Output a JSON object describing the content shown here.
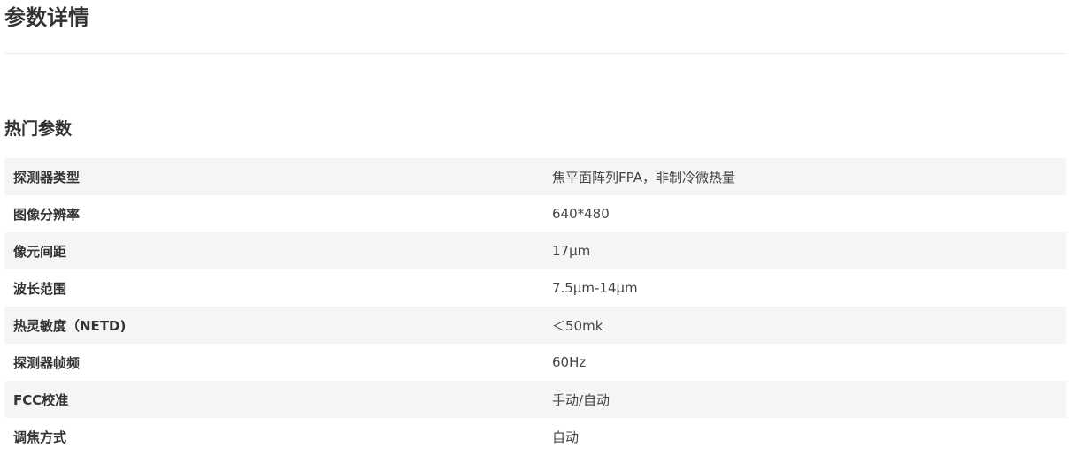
{
  "page": {
    "title": "参数详情"
  },
  "section": {
    "title": "热门参数"
  },
  "specs": [
    {
      "name": "探测器类型",
      "value": "焦平面阵列FPA，非制冷微热量"
    },
    {
      "name": "图像分辨率",
      "value": "640*480"
    },
    {
      "name": "像元间距",
      "value": "17μm"
    },
    {
      "name": "波长范围",
      "value": "7.5μm-14μm"
    },
    {
      "name": "热灵敏度（NETD)",
      "value": "＜50mk"
    },
    {
      "name": "探测器帧频",
      "value": "60Hz"
    },
    {
      "name": "FCC校准",
      "value": "手动/自动"
    },
    {
      "name": "调焦方式",
      "value": "自动"
    }
  ],
  "colors": {
    "text": "#333333",
    "row_stripe": "#f5f5f5",
    "divider": "#eeeeee"
  }
}
